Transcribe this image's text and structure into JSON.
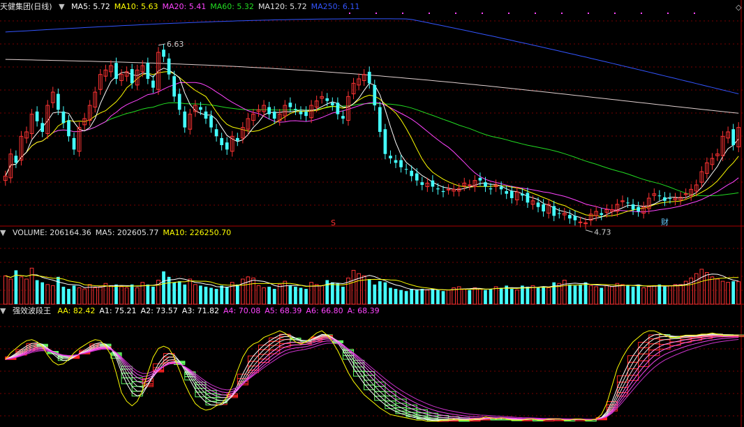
{
  "panels": {
    "price": {
      "title": "天健集团(日线)",
      "indicators": [
        {
          "label": "MA5: 5.72",
          "color": "#ffffff"
        },
        {
          "label": "MA10: 5.63",
          "color": "#ffff00"
        },
        {
          "label": "MA20: 5.41",
          "color": "#ff44ff"
        },
        {
          "label": "MA60: 5.32",
          "color": "#22dd22"
        },
        {
          "label": "MA120: 5.72",
          "color": "#e0e0e0"
        },
        {
          "label": "MA250: 6.11",
          "color": "#3355ff"
        }
      ],
      "high_label": "6.63",
      "low_label": "4.73",
      "marker_s": "S",
      "marker_cai": "财"
    },
    "volume": {
      "indicators": [
        {
          "label": "VOLUME: 206164.36",
          "color": "#e0e0e0"
        },
        {
          "label": "MA5: 202605.77",
          "color": "#e0e0e0"
        },
        {
          "label": "MA10: 226250.70",
          "color": "#ffff00"
        }
      ]
    },
    "wave": {
      "title": "强效波段王",
      "indicators": [
        {
          "label": "AA: 82.42",
          "color": "#ffff00"
        },
        {
          "label": "A1: 75.21",
          "color": "#ffffff"
        },
        {
          "label": "A2: 73.57",
          "color": "#ffffff"
        },
        {
          "label": "A3: 71.82",
          "color": "#ffffff"
        },
        {
          "label": "A4: 70.08",
          "color": "#ff44ff"
        },
        {
          "label": "A5: 68.39",
          "color": "#ff44ff"
        },
        {
          "label": "A6: 66.80",
          "color": "#ff44ff"
        },
        {
          "label": "A: 68.39",
          "color": "#ff44ff"
        }
      ]
    }
  },
  "chart_data": {
    "type": "candlestick",
    "price_range": [
      4.55,
      6.95
    ],
    "close": [
      5.1,
      5.35,
      5.25,
      5.55,
      5.6,
      5.8,
      5.72,
      5.6,
      5.9,
      6.05,
      5.85,
      5.7,
      5.55,
      5.4,
      5.65,
      5.75,
      5.9,
      6.05,
      6.25,
      6.3,
      6.35,
      6.2,
      6.25,
      6.28,
      6.15,
      6.3,
      6.35,
      6.2,
      6.1,
      6.5,
      6.45,
      6.25,
      6.0,
      5.85,
      5.65,
      5.8,
      5.9,
      5.85,
      5.75,
      5.65,
      5.55,
      5.45,
      5.4,
      5.55,
      5.5,
      5.65,
      5.75,
      5.8,
      5.85,
      5.9,
      5.8,
      5.75,
      5.8,
      5.9,
      5.88,
      5.85,
      5.8,
      5.78,
      5.9,
      5.95,
      6.0,
      5.95,
      5.9,
      5.8,
      5.75,
      6.0,
      6.15,
      6.2,
      6.25,
      6.15,
      5.9,
      5.6,
      5.35,
      5.3,
      5.25,
      5.2,
      5.18,
      5.1,
      5.05,
      5.0,
      5.02,
      4.98,
      4.95,
      4.92,
      4.95,
      4.95,
      4.96,
      5.02,
      5.0,
      5.05,
      5.05,
      4.98,
      4.95,
      5.0,
      4.95,
      4.9,
      4.85,
      4.92,
      4.88,
      4.8,
      4.82,
      4.75,
      4.7,
      4.78,
      4.65,
      4.68,
      4.68,
      4.62,
      4.6,
      4.58,
      4.57,
      4.67,
      4.7,
      4.66,
      4.72,
      4.72,
      4.78,
      4.82,
      4.8,
      4.72,
      4.7,
      4.75,
      4.85,
      4.9,
      4.88,
      4.82,
      4.85,
      4.85,
      4.86,
      4.9,
      4.95,
      5.0,
      5.15,
      5.25,
      5.3,
      5.35,
      5.55,
      5.6,
      5.45,
      5.65
    ],
    "volume_range": [
      0,
      600000
    ],
    "volume": [
      260000,
      230000,
      310000,
      250000,
      230000,
      330000,
      220000,
      200000,
      180000,
      170000,
      250000,
      160000,
      140000,
      170000,
      150000,
      140000,
      180000,
      150000,
      160000,
      190000,
      170000,
      180000,
      160000,
      150000,
      180000,
      150000,
      200000,
      180000,
      160000,
      220000,
      300000,
      250000,
      200000,
      210000,
      180000,
      230000,
      180000,
      170000,
      160000,
      150000,
      140000,
      170000,
      160000,
      200000,
      180000,
      230000,
      250000,
      240000,
      170000,
      150000,
      160000,
      140000,
      180000,
      210000,
      170000,
      160000,
      150000,
      140000,
      200000,
      180000,
      170000,
      220000,
      200000,
      190000,
      160000,
      240000,
      310000,
      280000,
      260000,
      230000,
      180000,
      210000,
      200000,
      150000,
      140000,
      130000,
      120000,
      140000,
      130000,
      140000,
      130000,
      140000,
      130000,
      120000,
      130000,
      150000,
      160000,
      140000,
      130000,
      150000,
      140000,
      130000,
      140000,
      160000,
      150000,
      170000,
      140000,
      130000,
      170000,
      160000,
      170000,
      150000,
      160000,
      150000,
      200000,
      190000,
      220000,
      180000,
      170000,
      180000,
      200000,
      170000,
      160000,
      150000,
      170000,
      160000,
      190000,
      180000,
      170000,
      160000,
      180000,
      150000,
      160000,
      170000,
      180000,
      160000,
      170000,
      180000,
      180000,
      210000,
      240000,
      280000,
      320000,
      290000,
      250000,
      230000,
      210000,
      200000,
      210000,
      206164
    ],
    "wave_range": [
      0,
      100
    ],
    "aa": [
      60,
      66,
      70,
      74,
      77,
      78,
      76,
      72,
      64,
      58,
      55,
      56,
      60,
      66,
      70,
      73,
      76,
      78,
      77,
      72,
      64,
      48,
      30,
      22,
      18,
      22,
      32,
      48,
      62,
      70,
      72,
      70,
      62,
      50,
      38,
      28,
      20,
      16,
      14,
      15,
      18,
      20,
      26,
      36,
      50,
      62,
      70,
      74,
      76,
      80,
      82,
      84,
      86,
      84,
      80,
      76,
      74,
      76,
      80,
      84,
      86,
      82,
      76,
      68,
      58,
      48,
      40,
      34,
      28,
      24,
      20,
      16,
      13,
      10,
      9,
      8,
      7,
      6,
      5,
      5,
      4,
      4,
      4,
      5,
      5,
      6,
      5,
      5,
      5,
      6,
      6,
      8,
      7,
      6,
      7,
      6,
      5,
      5,
      5,
      6,
      6,
      5,
      5,
      6,
      6,
      6,
      5,
      5,
      6,
      6,
      5,
      5,
      6,
      10,
      20,
      36,
      52,
      62,
      70,
      76,
      80,
      84,
      86,
      86,
      84,
      82,
      80,
      80,
      81,
      82,
      82,
      82,
      83,
      83,
      84,
      83,
      82,
      82,
      82,
      82
    ],
    "ma_prices": {
      "ma5": 5.72,
      "ma10": 5.63,
      "ma20": 5.41,
      "ma60": 5.32,
      "ma120": 5.72,
      "ma250": 6.11
    }
  }
}
